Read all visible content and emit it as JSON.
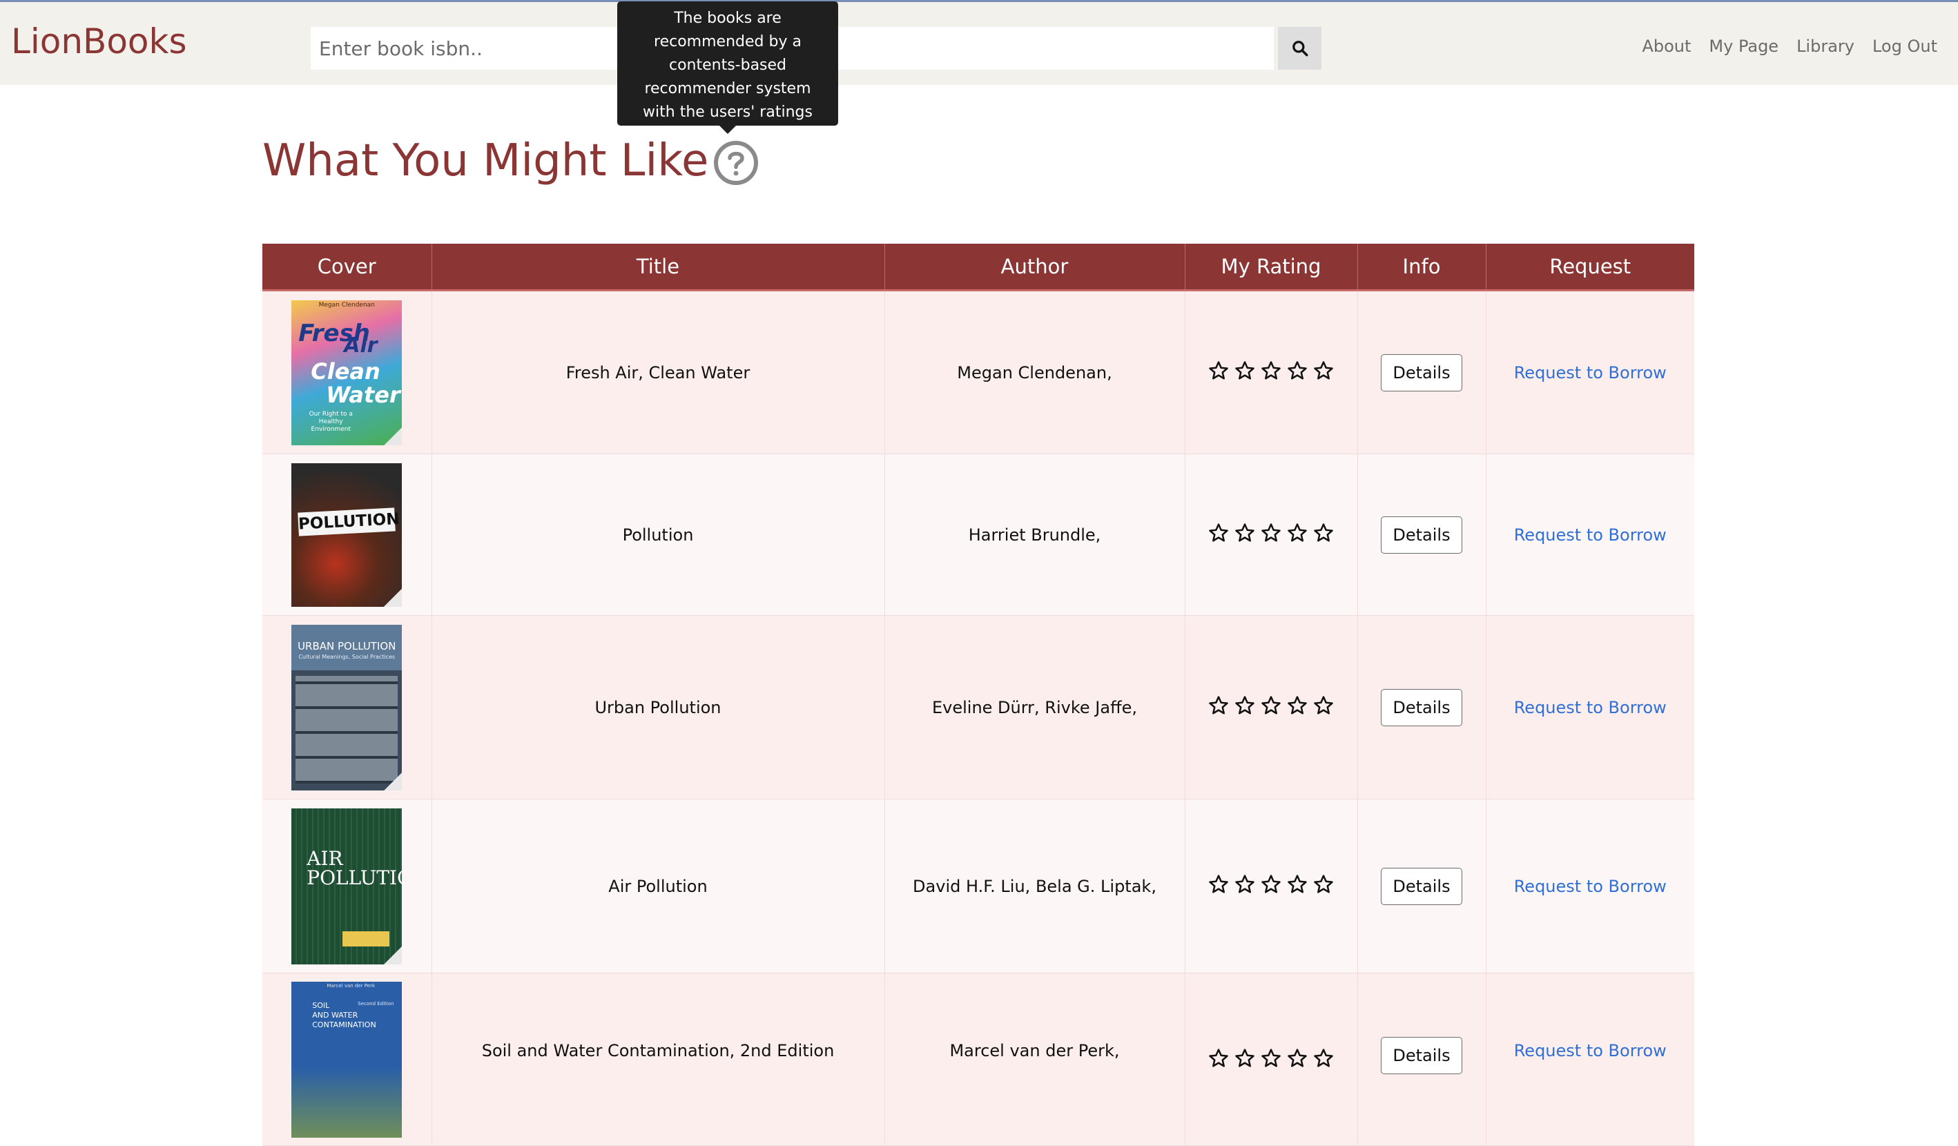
{
  "brand": "LionBooks",
  "search": {
    "placeholder": "Enter book isbn..",
    "icon": "search-icon"
  },
  "nav": {
    "links": [
      "About",
      "My Page",
      "Library",
      "Log Out"
    ]
  },
  "tooltip": "The books are recommended by a contents-based recommender system with the users' ratings",
  "page": {
    "title": "What You Might Like",
    "help_icon": "question-circle-icon"
  },
  "table": {
    "headers": [
      "Cover",
      "Title",
      "Author",
      "My Rating",
      "Info",
      "Request"
    ],
    "rows": [
      {
        "title": "Fresh Air, Clean Water",
        "author": "Megan Clendenan,",
        "rating": 0,
        "details": "Details",
        "request": "Request to Borrow"
      },
      {
        "title": "Pollution",
        "author": "Harriet Brundle,",
        "rating": 0,
        "details": "Details",
        "request": "Request to Borrow"
      },
      {
        "title": "Urban Pollution",
        "author": "Eveline Dürr, Rivke Jaffe,",
        "rating": 0,
        "details": "Details",
        "request": "Request to Borrow"
      },
      {
        "title": "Air Pollution",
        "author": "David H.F. Liu, Bela G. Liptak,",
        "rating": 0,
        "details": "Details",
        "request": "Request to Borrow"
      },
      {
        "title": "Soil and Water Contamination, 2nd Edition",
        "author": "Marcel van der Perk,",
        "rating": 0,
        "details": "Details",
        "request": "Request to Borrow"
      }
    ],
    "star_count": 5
  },
  "covers": {
    "fresh_air": {
      "lines": [
        "Fresh",
        "Air",
        "Clean",
        "Water"
      ],
      "author": "Megan Clendenan",
      "tagline": "Our Right to a Healthy Environment"
    },
    "pollution": {
      "lines": [
        "POLLUTION"
      ]
    },
    "urban_pollution": {
      "lines": [
        "URBAN POLLUTION",
        "Cultural Meanings, Social Practices"
      ]
    },
    "air_pollution": {
      "lines": [
        "AIR",
        "POLLUTION"
      ]
    },
    "soil": {
      "lines": [
        "SOIL",
        "AND WATER",
        "CONTAMINATION"
      ],
      "author": "Marcel van der Perk",
      "edition": "Second Edition"
    }
  },
  "colors": {
    "brand": "#8b3535",
    "header_bg": "#8b3535",
    "link": "#2f6fd6",
    "navbar_bg": "#f3f1ec"
  }
}
